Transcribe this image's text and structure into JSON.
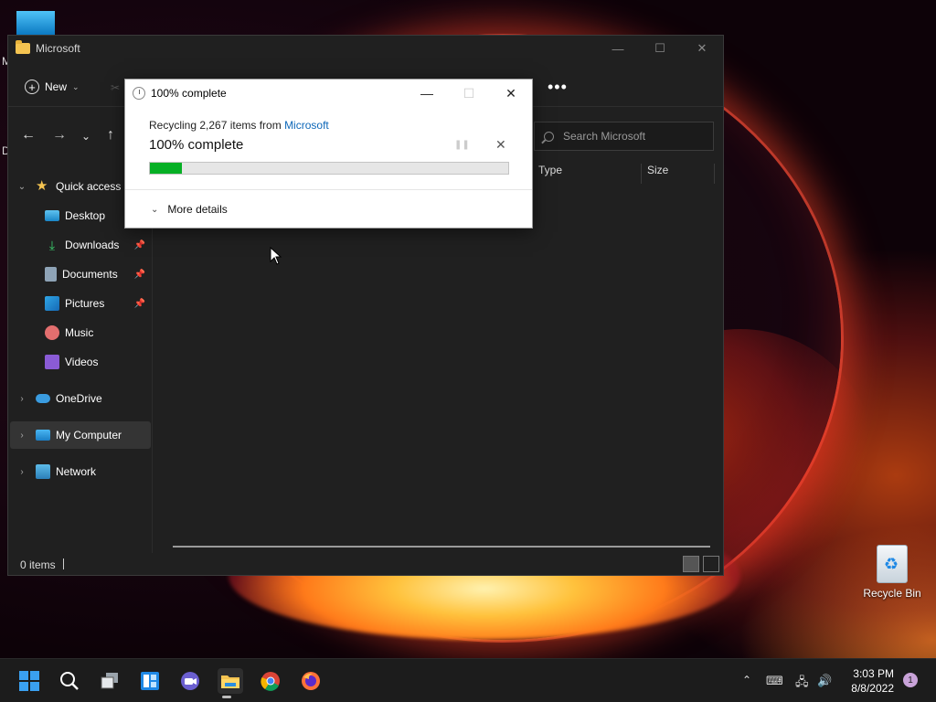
{
  "desktop": {
    "letter_m": "M",
    "letter_d": "D",
    "recycle_bin_label": "Recycle Bin"
  },
  "explorer": {
    "title": "Microsoft",
    "toolbar": {
      "new_label": "New",
      "more_label": "•••"
    },
    "search": {
      "placeholder": "Search Microsoft"
    },
    "sidebar": {
      "items": [
        {
          "label": "Quick access",
          "icon": "star-icon"
        },
        {
          "label": "Desktop",
          "icon": "desktop-icon"
        },
        {
          "label": "Downloads",
          "icon": "download-icon",
          "pinned": true
        },
        {
          "label": "Documents",
          "icon": "document-icon",
          "pinned": true
        },
        {
          "label": "Pictures",
          "icon": "pictures-icon",
          "pinned": true
        },
        {
          "label": "Music",
          "icon": "music-icon"
        },
        {
          "label": "Videos",
          "icon": "videos-icon"
        },
        {
          "label": "OneDrive",
          "icon": "cloud-icon"
        },
        {
          "label": "My Computer",
          "icon": "computer-icon",
          "selected": true
        },
        {
          "label": "Network",
          "icon": "network-icon"
        }
      ]
    },
    "columns": {
      "type": "Type",
      "size": "Size"
    },
    "status": {
      "items_count": "0 items"
    }
  },
  "dialog": {
    "title": "100% complete",
    "line1_prefix": "Recycling 2,267 items from ",
    "line1_source": "Microsoft",
    "big_status": "100% complete",
    "progress_percent": 9,
    "more_details": "More details"
  },
  "taskbar": {
    "apps": [
      "start-icon",
      "search-icon",
      "task-view-icon",
      "widgets-icon",
      "chat-icon",
      "file-explorer-icon",
      "chrome-icon",
      "firefox-icon"
    ],
    "time": "3:03 PM",
    "date": "8/8/2022",
    "notification_count": "1"
  },
  "colors": {
    "progress_fill": "#06b025",
    "link": "#0d67b8",
    "accent_blue": "#0078d4"
  }
}
